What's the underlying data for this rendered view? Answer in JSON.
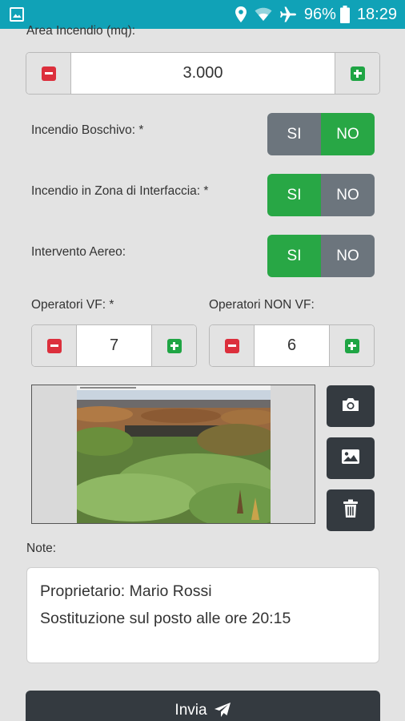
{
  "status_bar": {
    "left_icon": "image-notification-icon",
    "icons": [
      "location-icon",
      "wifi-icon",
      "airplane-icon",
      "battery-icon"
    ],
    "battery": "96%",
    "time": "18:29"
  },
  "form": {
    "area_label": "Area Incendio (mq):",
    "area_value": "3.000",
    "boschivo_label": "Incendio Boschivo: *",
    "interfaccia_label": "Incendio in Zona di Interfaccia: *",
    "aereo_label": "Intervento Aereo:",
    "toggles": {
      "si": "SI",
      "no": "NO",
      "boschivo_selected": "NO",
      "interfaccia_selected": "SI",
      "aereo_selected": "SI"
    },
    "operatori_vf_label": "Operatori VF: *",
    "operatori_vf_value": "7",
    "operatori_non_vf_label": "Operatori NON VF:",
    "operatori_non_vf_value": "6",
    "notes_label": "Note:",
    "notes_lines": [
      "Proprietario: Mario Rossi",
      "Sostituzione sul posto alle ore 20:15"
    ],
    "submit_label": "Invia"
  },
  "colors": {
    "status_bar": "#10a2b7",
    "toggle_on": "#28a745",
    "toggle_off": "#6c757d",
    "dark_button": "#343a40",
    "minus_icon": "#dc2f3c",
    "plus_icon": "#1fa544"
  }
}
